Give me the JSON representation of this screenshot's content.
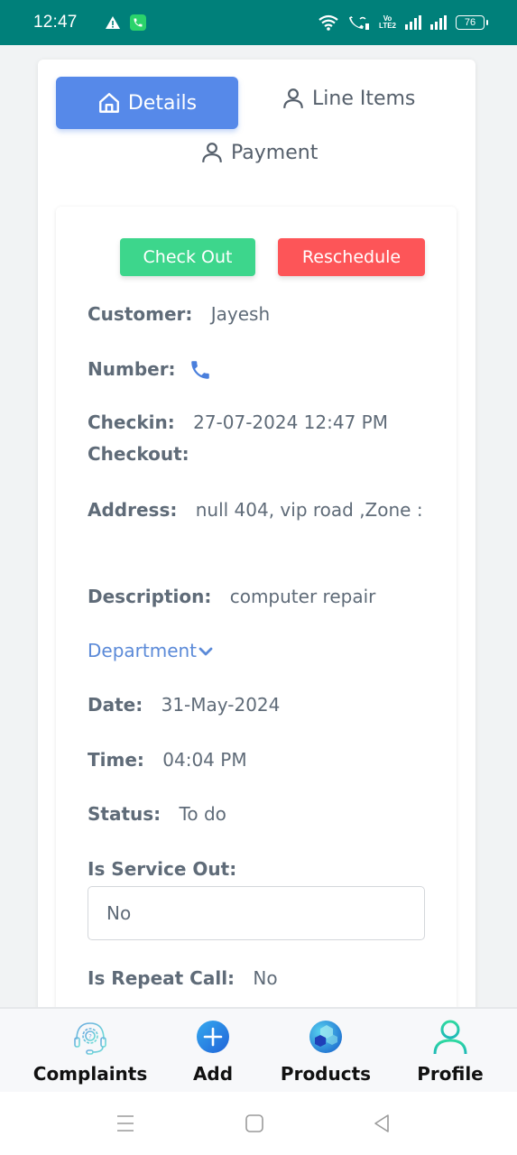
{
  "status_bar": {
    "time": "12:47",
    "battery": "76",
    "volte_line1": "Vo",
    "volte_line2": "LTE2",
    "icons": [
      "warning-icon",
      "phone-app-icon",
      "wifi-icon",
      "wifi-calling-icon",
      "volte-icon",
      "signal-icon",
      "signal-icon",
      "battery-icon"
    ]
  },
  "tabs": [
    {
      "label": "Details",
      "icon": "home-icon",
      "active": true
    },
    {
      "label": "Line Items",
      "icon": "user-icon",
      "active": false
    },
    {
      "label": "Payment",
      "icon": "user-icon",
      "active": false
    }
  ],
  "actions": {
    "checkout_label": "Check Out",
    "reschedule_label": "Reschedule"
  },
  "colors": {
    "status_bar": "#00807a",
    "active_tab": "#5689e9",
    "checkout": "#3dd68c",
    "reschedule": "#fd5558",
    "link": "#5b8ad8"
  },
  "details": {
    "customer": {
      "label": "Customer:",
      "value": "Jayesh"
    },
    "number": {
      "label": "Number:",
      "icon": "phone-icon"
    },
    "checkin": {
      "label": "Checkin:",
      "value": "27-07-2024 12:47 PM"
    },
    "checkout": {
      "label": "Checkout:",
      "value": ""
    },
    "address": {
      "label": "Address:",
      "value": "null 404, vip road ,Zone :"
    },
    "description": {
      "label": "Description:",
      "value": "computer repair"
    },
    "department": {
      "label": "Department"
    },
    "date": {
      "label": "Date:",
      "value": "31-May-2024"
    },
    "time": {
      "label": "Time:",
      "value": "04:04 PM"
    },
    "status": {
      "label": "Status:",
      "value": "To do"
    },
    "is_service_out": {
      "label": "Is Service Out:",
      "value": "No"
    },
    "is_repeat_call": {
      "label": "Is Repeat Call:",
      "value": "No"
    }
  },
  "bottom_nav": [
    {
      "label": "Complaints",
      "icon": "support-headset-icon"
    },
    {
      "label": "Add",
      "icon": "add-circle-icon"
    },
    {
      "label": "Products",
      "icon": "cubes-icon"
    },
    {
      "label": "Profile",
      "icon": "profile-icon"
    }
  ]
}
